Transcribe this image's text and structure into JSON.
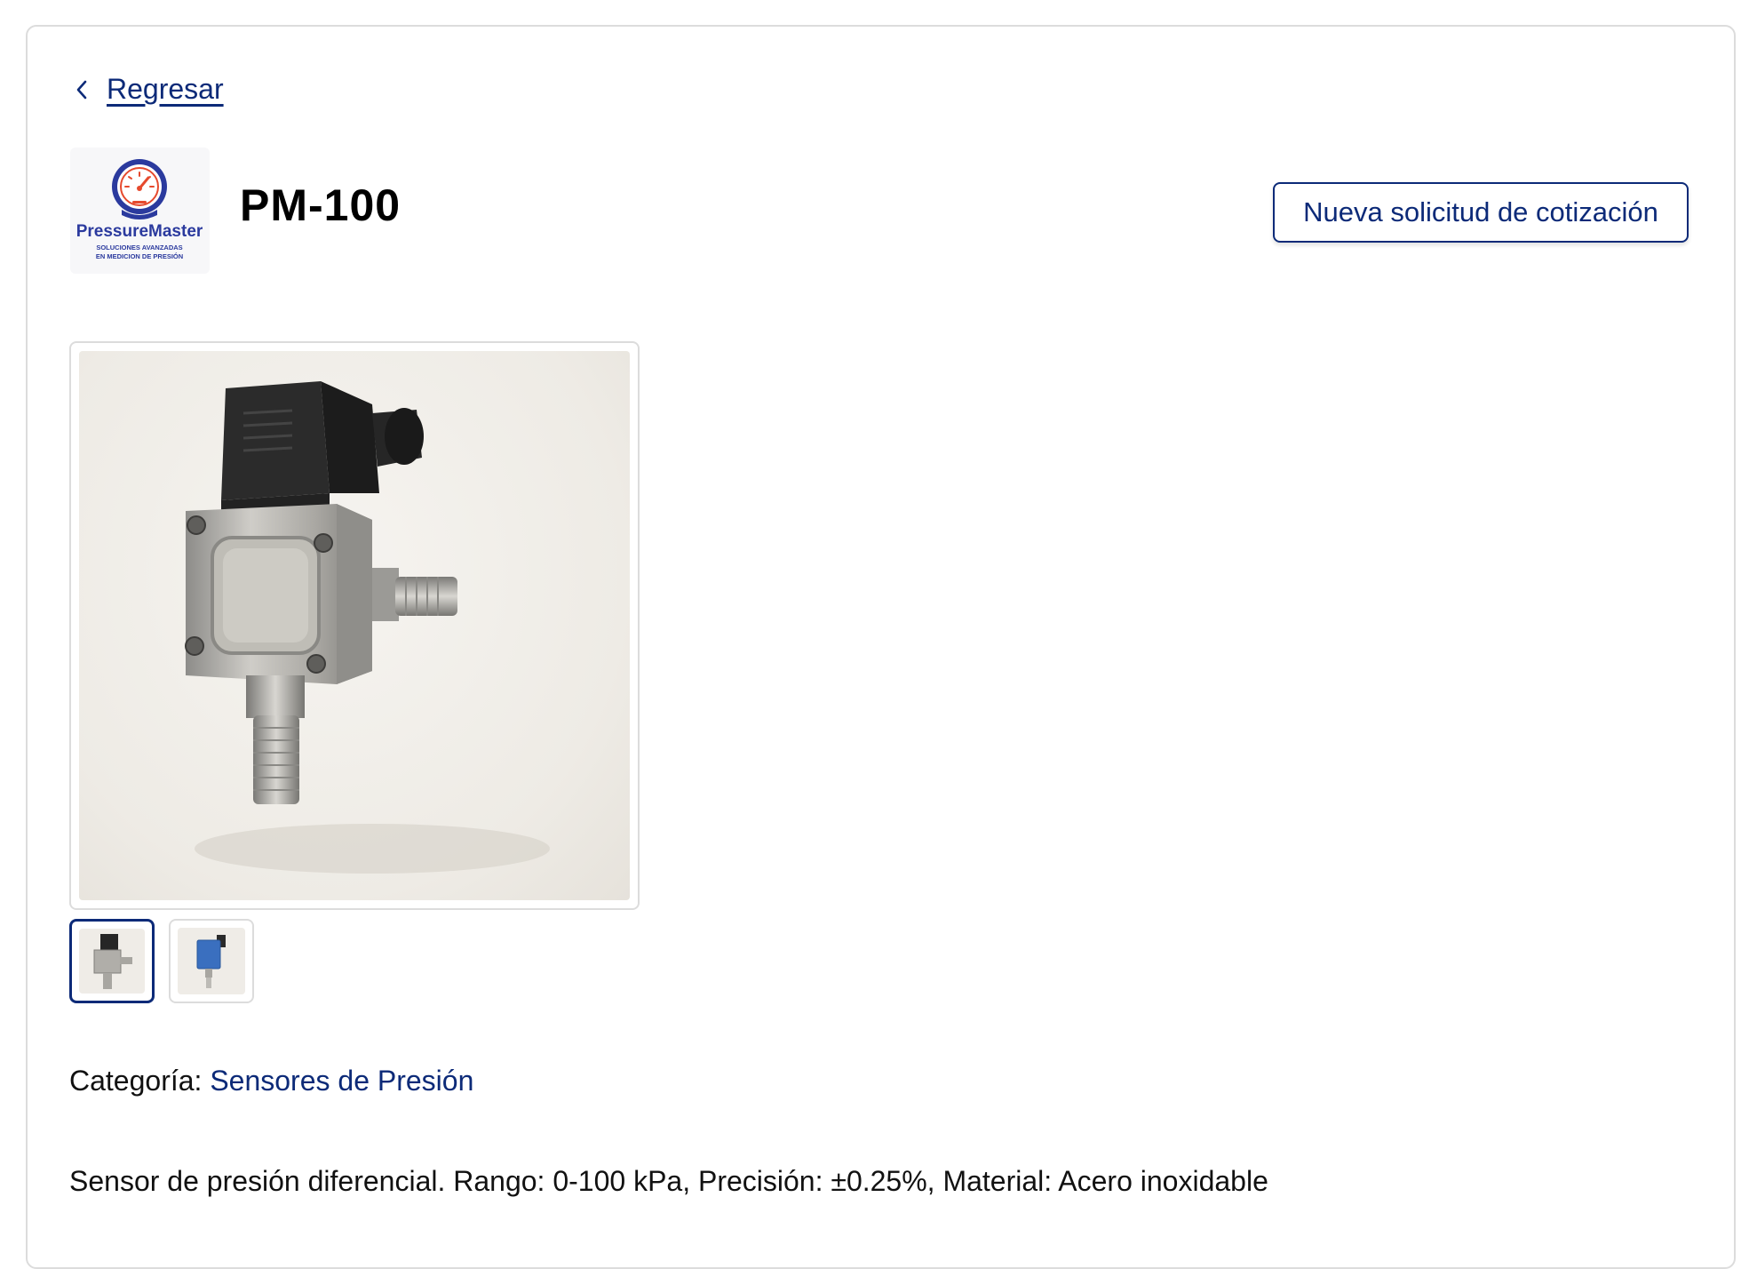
{
  "nav": {
    "back_label": "Regresar"
  },
  "brand": {
    "logo_name": "PressureMaster",
    "logo_tagline_1": "SOLUCIONES AVANZADAS",
    "logo_tagline_2": "EN MEDICION DE PRESIÓN"
  },
  "product": {
    "title": "PM-100",
    "category_label": "Categoría:",
    "category_value": "Sensores de Presión",
    "description": "Sensor de presión diferencial. Rango: 0-100 kPa, Precisión: ±0.25%, Material: Acero inoxidable"
  },
  "actions": {
    "quote_button": "Nueva solicitud de cotización"
  },
  "gallery": {
    "selected_index": 0,
    "thumbnails": [
      {
        "icon": "pressure-sensor-steel-image"
      },
      {
        "icon": "pressure-sensor-blue-image"
      }
    ]
  },
  "colors": {
    "accent": "#0c2a78",
    "border": "#dcdcdc",
    "logo_red": "#e64a2e",
    "logo_blue": "#2b3a9e"
  }
}
